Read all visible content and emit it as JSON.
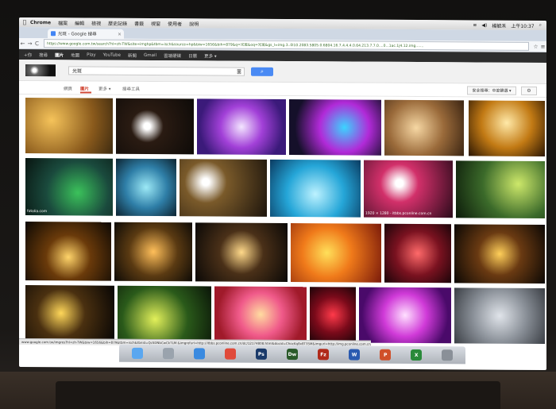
{
  "menubar": {
    "app": "Chrome",
    "items": [
      "檔案",
      "編輯",
      "檢視",
      "歷史記錄",
      "書籤",
      "視窗",
      "使用者",
      "說明"
    ],
    "user": "楊毓禾",
    "time": "上午10:37"
  },
  "browser": {
    "tab_title": "光斑 - Google 搜尋",
    "url": "https://www.google.com.tw/search?hl=zh-TW&site=imghp&tbm=isch&source=hp&biw=1656&bih=879&q=光斑&oq=光斑&gs_l=img.3..0l10.2083.5805.0.6804.16.7.4.4.4.0.64.213.7.7.0....0...1ac.1j4.12.img.......",
    "nav_back": "←",
    "nav_forward": "→",
    "nav_reload": "C"
  },
  "google_bar": {
    "items": [
      "+你",
      "搜尋",
      "圖片",
      "地圖",
      "Play",
      "YouTube",
      "新聞",
      "Gmail",
      "雲端硬碟",
      "日曆",
      "更多 ▾"
    ]
  },
  "search": {
    "query": "光斑",
    "button_icon": "search-icon"
  },
  "tools": {
    "tabs": [
      "網頁",
      "圖片",
      "更多 ▾",
      "搜尋工具"
    ],
    "active": "圖片",
    "safe_search": "安全搜尋：中度篩選 ▾",
    "settings_icon": "gear-icon"
  },
  "images": [
    {
      "caption": ""
    },
    {
      "caption": ""
    },
    {
      "caption": ""
    },
    {
      "caption": ""
    },
    {
      "caption": ""
    },
    {
      "caption": ""
    },
    {
      "caption": "fotolia.com"
    },
    {
      "caption": ""
    },
    {
      "caption": ""
    },
    {
      "caption": ""
    },
    {
      "caption": "1920 × 1280 - itbbs.pconline.com.cn"
    },
    {
      "caption": ""
    },
    {
      "caption": ""
    },
    {
      "caption": ""
    },
    {
      "caption": ""
    },
    {
      "caption": ""
    },
    {
      "caption": ""
    },
    {
      "caption": ""
    },
    {
      "caption": ""
    },
    {
      "caption": ""
    },
    {
      "caption": ""
    },
    {
      "caption": ""
    },
    {
      "caption": ""
    },
    {
      "caption": ""
    }
  ],
  "status_bar": "www.google.com.tw/imgres?hl=zh-TW&biw=1656&bih=879&tbm=isch&tbnid=QcSDNbCwCkTLM:&imgrefurl=http://itbbs.pconline.com.cn/dc/12174808.html&docid=ChocKq8x8T35M&imgurl=http://img.pconline.com.cn/images/upload/upc/tx/itbbs/1011/25/c1/5958902_1290849068930_1024x1024it.jpg",
  "dock": [
    {
      "icon": "finder-icon",
      "label": ""
    },
    {
      "icon": "launchpad-icon",
      "label": ""
    },
    {
      "icon": "safari-icon",
      "label": ""
    },
    {
      "icon": "chrome-icon",
      "label": ""
    },
    {
      "icon": "photoshop-icon",
      "label": "Ps"
    },
    {
      "icon": "dreamweaver-icon",
      "label": "Dw"
    },
    {
      "icon": "filezilla-icon",
      "label": "Fz"
    },
    {
      "icon": "word-icon",
      "label": "W"
    },
    {
      "icon": "powerpoint-icon",
      "label": "P"
    },
    {
      "icon": "excel-icon",
      "label": "X"
    },
    {
      "icon": "trash-icon",
      "label": ""
    }
  ]
}
